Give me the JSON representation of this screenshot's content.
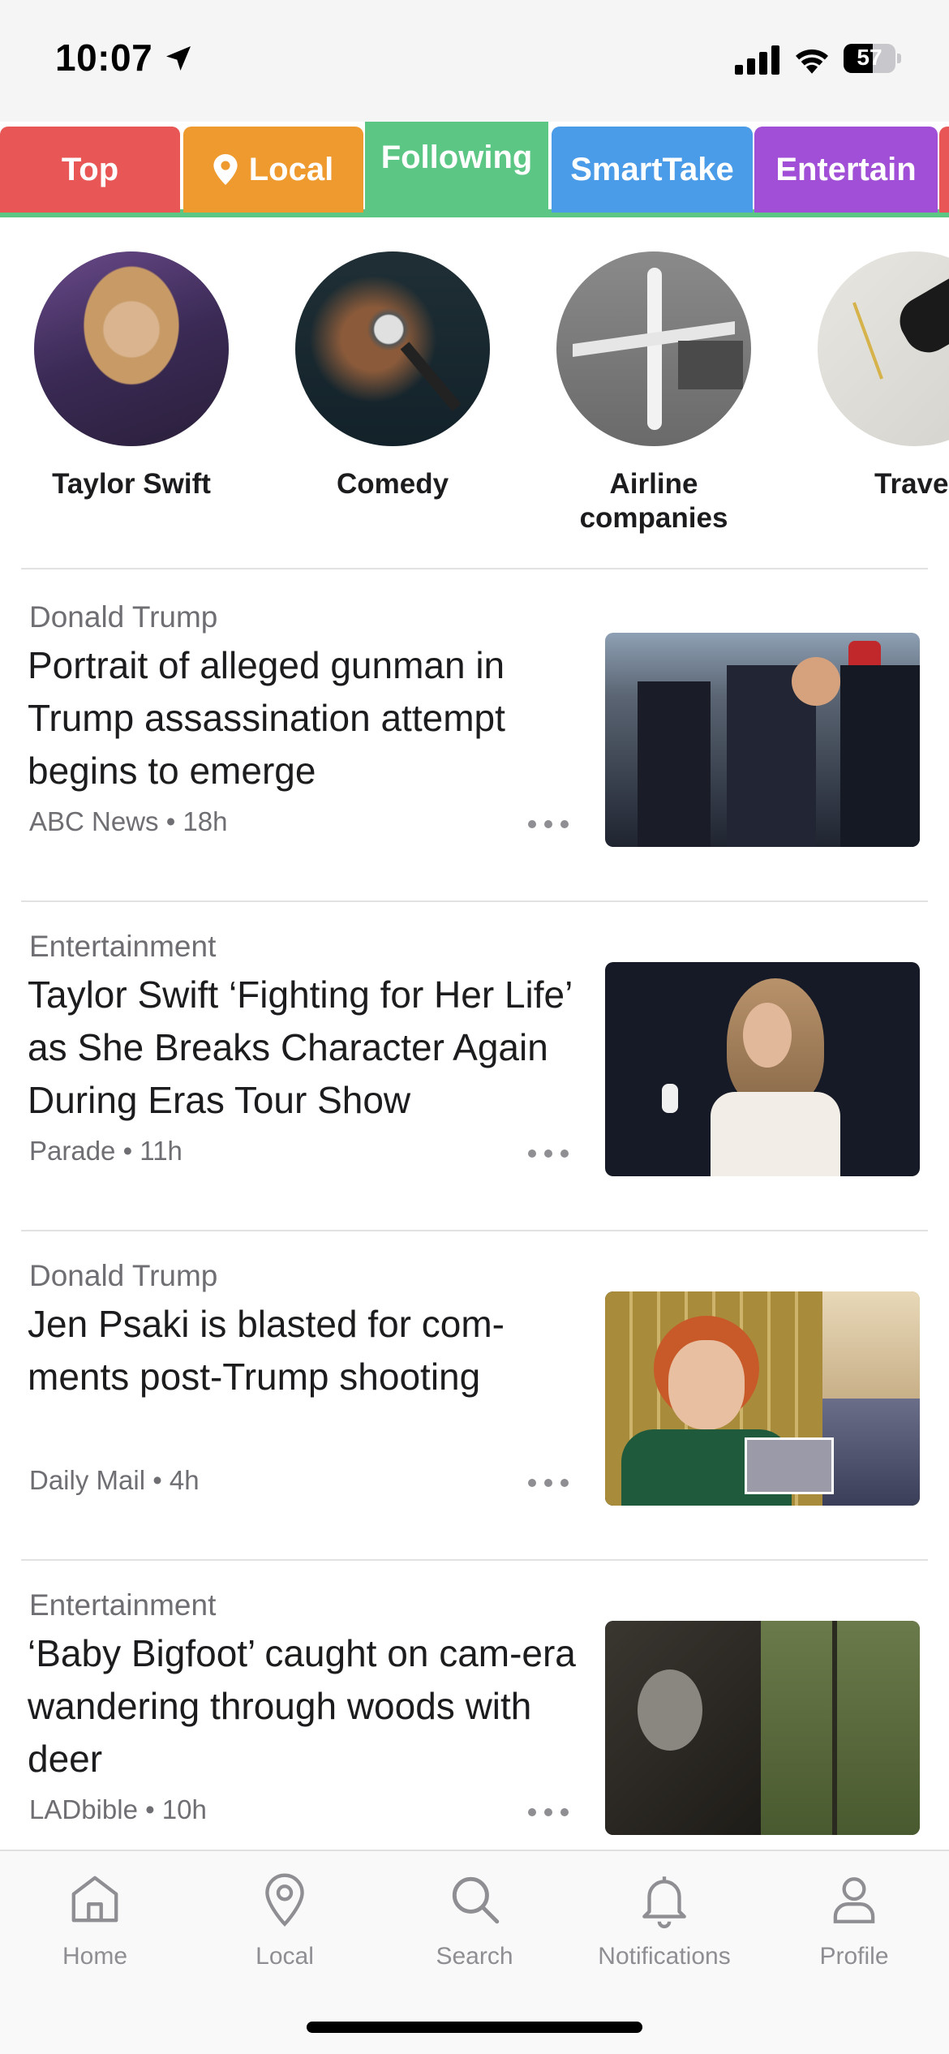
{
  "status": {
    "time": "10:07",
    "battery": "57",
    "battery_level": 0.57
  },
  "tabs": [
    {
      "label": "Top",
      "color": "#e85656"
    },
    {
      "label": "Local",
      "color": "#ef9a2f",
      "icon": "pin-icon"
    },
    {
      "label": "Following",
      "color": "#5cc784",
      "active": true
    },
    {
      "label": "SmartTake",
      "color": "#4a9be8"
    },
    {
      "label": "Entertain",
      "color": "#a04fd6"
    }
  ],
  "topics": [
    {
      "name": "Taylor Swift"
    },
    {
      "name": "Comedy"
    },
    {
      "name": "Airline companies"
    },
    {
      "name": "Trave"
    }
  ],
  "articles": [
    {
      "category": "Donald Trump",
      "headline": "Portrait of alleged gunman in Trump assassination attempt begins to emerge",
      "source": "ABC News",
      "age": "18h",
      "meta": "ABC News • 18h"
    },
    {
      "category": "Entertainment",
      "headline": "Taylor Swift ‘Fighting for Her Life’ as She Breaks Character Again During Eras Tour Show",
      "source": "Parade",
      "age": "11h",
      "meta": "Parade • 11h"
    },
    {
      "category": "Donald Trump",
      "headline": "Jen Psaki is blasted for com-ments post-Trump shooting",
      "source": "Daily Mail",
      "age": "4h",
      "meta": "Daily Mail • 4h"
    },
    {
      "category": "Entertainment",
      "headline": "‘Baby Bigfoot’ caught on cam-era wandering through woods with deer",
      "source": "LADbible",
      "age": "10h",
      "meta": "LADbible • 10h"
    }
  ],
  "nav": [
    {
      "label": "Home",
      "icon": "home-icon"
    },
    {
      "label": "Local",
      "icon": "location-pin-icon"
    },
    {
      "label": "Search",
      "icon": "search-icon"
    },
    {
      "label": "Notifications",
      "icon": "bell-icon"
    },
    {
      "label": "Profile",
      "icon": "person-icon"
    }
  ]
}
